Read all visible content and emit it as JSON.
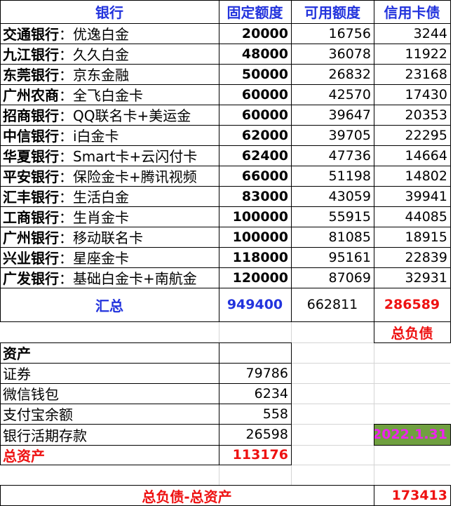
{
  "headers": {
    "bank": "银行",
    "fixed": "固定额度",
    "available": "可用额度",
    "debt": "信用卡债"
  },
  "rows": [
    {
      "bank": "交通银行",
      "card": "：优逸白金",
      "fixed": "20000",
      "available": "16756",
      "debt": "3244"
    },
    {
      "bank": "九江银行",
      "card": "：久久白金",
      "fixed": "48000",
      "available": "36078",
      "debt": "11922"
    },
    {
      "bank": "东莞银行",
      "card": "：京东金融",
      "fixed": "50000",
      "available": "26832",
      "debt": "23168"
    },
    {
      "bank": "广州农商",
      "card": "：全飞白金卡",
      "fixed": "60000",
      "available": "42570",
      "debt": "17430"
    },
    {
      "bank": "招商银行",
      "card": "：QQ联名卡+美运金",
      "fixed": "60000",
      "available": "39647",
      "debt": "20353"
    },
    {
      "bank": "中信银行",
      "card": "：i白金卡",
      "fixed": "62000",
      "available": "39705",
      "debt": "22295"
    },
    {
      "bank": "华夏银行",
      "card": "：Smart卡+云闪付卡",
      "fixed": "62400",
      "available": "47736",
      "debt": "14664"
    },
    {
      "bank": "平安银行",
      "card": "：保险金卡+腾讯视频",
      "fixed": "66000",
      "available": "51198",
      "debt": "14802"
    },
    {
      "bank": "汇丰银行",
      "card": "：生活白金",
      "fixed": "83000",
      "available": "43059",
      "debt": "39941"
    },
    {
      "bank": "工商银行",
      "card": "：生肖金卡",
      "fixed": "100000",
      "available": "55915",
      "debt": "44085"
    },
    {
      "bank": "广州银行",
      "card": "：移动联名卡",
      "fixed": "100000",
      "available": "81085",
      "debt": "18915"
    },
    {
      "bank": "兴业银行",
      "card": "：星座金卡",
      "fixed": "118000",
      "available": "95161",
      "debt": "22839"
    },
    {
      "bank": "广发银行",
      "card": "：基础白金卡+南航金",
      "fixed": "120000",
      "available": "87069",
      "debt": "32931"
    }
  ],
  "total": {
    "label": "汇总",
    "fixed": "949400",
    "available": "662811",
    "debt": "286589"
  },
  "total_debt_label": "总负债",
  "assets": {
    "title": "资产",
    "items": [
      {
        "label": "证券",
        "value": "79786"
      },
      {
        "label": "微信钱包",
        "value": "6234"
      },
      {
        "label": "支付宝余额",
        "value": "558"
      },
      {
        "label": "银行活期存款",
        "value": "26598"
      }
    ],
    "total_label": "总资产",
    "total_value": "113176"
  },
  "date": "2022.1.31",
  "net": {
    "label": "总负债-总资产",
    "value": "173413"
  },
  "colors": {
    "header_blue": "#2233dd",
    "emphasis_red": "#ee1111",
    "date_bg": "#70a040",
    "date_text": "#ee22ee"
  }
}
